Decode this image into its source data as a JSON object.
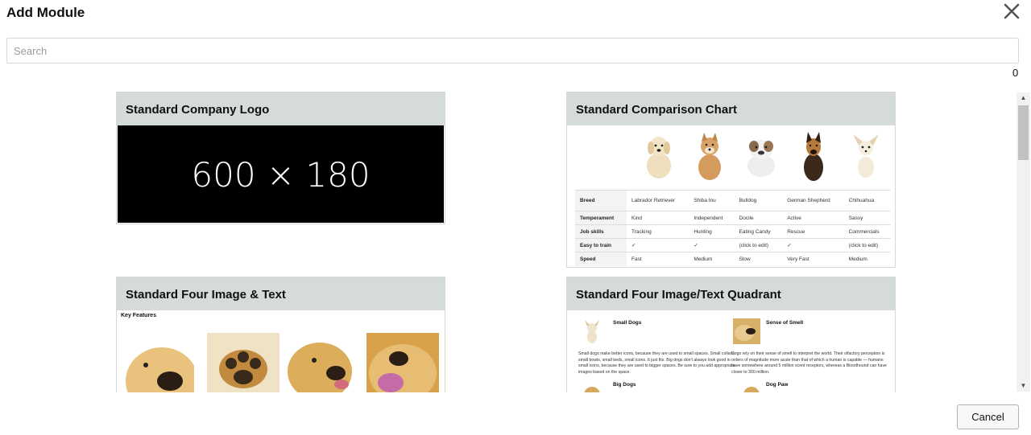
{
  "dialog": {
    "title": "Add Module",
    "search_placeholder": "Search",
    "result_count": "0",
    "cancel_label": "Cancel"
  },
  "modules": [
    {
      "title": "Standard Company Logo",
      "placeholder_text": "600 × 180"
    },
    {
      "title": "Standard Comparison Chart",
      "table": [
        [
          "Breed",
          "Labrador Retriever",
          "Shiba Inu",
          "Bulldog",
          "German Shepherd",
          "Chihuahua"
        ],
        [
          "Temperament",
          "Kind",
          "Independent",
          "Docile",
          "Active",
          "Sassy"
        ],
        [
          "Job skills",
          "Tracking",
          "Hunting",
          "Eating Candy",
          "Rescue",
          "Commercials"
        ],
        [
          "Easy to train",
          "✓",
          "✓",
          "(click to edit)",
          "✓",
          "(click to edit)"
        ],
        [
          "Speed",
          "Fast",
          "Medium",
          "Slow",
          "Very Fast",
          "Medium"
        ]
      ]
    },
    {
      "title": "Standard Four Image & Text",
      "subheading": "Key Features"
    },
    {
      "title": "Standard Four Image/Text Quadrant",
      "quadrants": [
        {
          "heading": "Small Dogs",
          "text": "Small dogs make better icons, because they are used to small spaces. Small collars, small bowls, small beds, small icons. It just fits. Big dogs don't always look good in small icons, because they are used to bigger spaces. Be sure to you add appropriate images based on the space."
        },
        {
          "heading": "Sense of Smell",
          "text": "Dogs rely on their sense of smell to interpret the world. Their olfactory perception is orders of magnitude more acute than that of which a human is capable — humans have somewhere around 5 million scent receptors, whereas a Bloodhound can have closer to 300 million."
        },
        {
          "heading": "Big Dogs",
          "text": ""
        },
        {
          "heading": "Dog Paw",
          "text": ""
        }
      ]
    }
  ],
  "icons": {
    "close": "close-x-icon",
    "scroll_up": "triangle-up-icon",
    "scroll_down": "triangle-down-icon"
  }
}
